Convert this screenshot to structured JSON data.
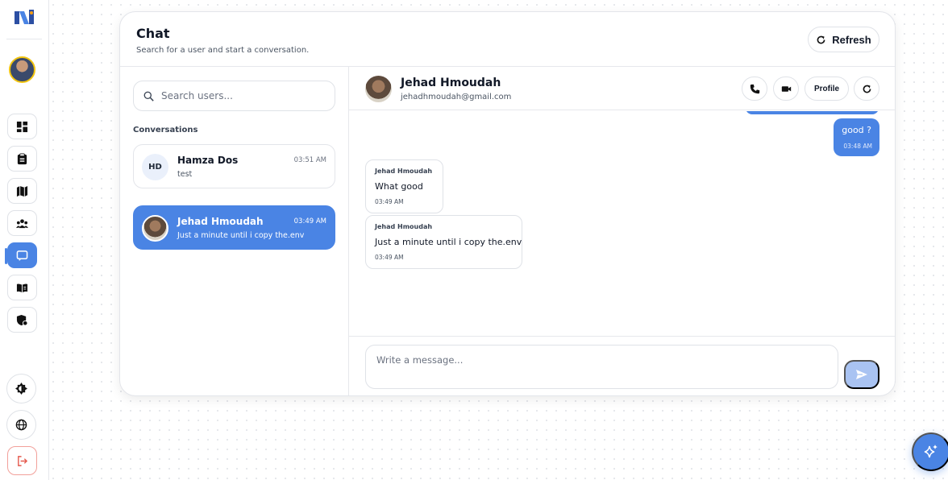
{
  "colors": {
    "accent": "#4a84e4",
    "send_disabled": "#a9c3f2",
    "logout": "#e55a4e"
  },
  "sidebar": {
    "items": [
      {
        "icon": "dashboard-icon"
      },
      {
        "icon": "clipboard-icon"
      },
      {
        "icon": "map-icon"
      },
      {
        "icon": "users-icon"
      },
      {
        "icon": "chat-icon",
        "active": true
      },
      {
        "icon": "book-icon"
      },
      {
        "icon": "shield-icon"
      }
    ],
    "bottom": [
      {
        "icon": "theme-toggle-icon"
      },
      {
        "icon": "globe-icon"
      },
      {
        "icon": "logout-icon"
      }
    ]
  },
  "header": {
    "title": "Chat",
    "subtitle": "Search for a user and start a conversation.",
    "refresh_label": "Refresh"
  },
  "conversations": {
    "search_placeholder": "Search users...",
    "section_label": "Conversations",
    "items": [
      {
        "initials": "HD",
        "name": "Hamza Dos",
        "time": "03:51 AM",
        "preview": "test",
        "active": false
      },
      {
        "name": "Jehad Hmoudah",
        "time": "03:49 AM",
        "preview": "Just a minute until i copy the.env",
        "active": true
      }
    ]
  },
  "chat": {
    "name": "Jehad Hmoudah",
    "email": "jehadhmoudah@gmail.com",
    "profile_label": "Profile",
    "messages": [
      {
        "direction": "out",
        "text": "good ?",
        "time": "03:48 AM"
      },
      {
        "direction": "in",
        "sender": "Jehad Hmoudah",
        "text": "What good",
        "time": "03:49 AM"
      },
      {
        "direction": "in",
        "sender": "Jehad Hmoudah",
        "text": "Just a minute until i copy the.env",
        "time": "03:49 AM"
      }
    ],
    "composer_placeholder": "Write a message..."
  }
}
